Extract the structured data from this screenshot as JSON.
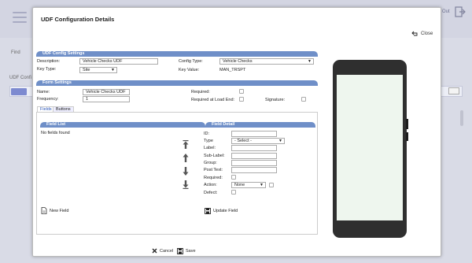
{
  "background": {
    "out_label": "Out",
    "find_label": "Find",
    "udf_config_label": "UDF Confi"
  },
  "modal": {
    "title": "UDF Configuration Details",
    "close_label": "Close"
  },
  "udf_config": {
    "header": "UDF Config Settings",
    "description_label": "Description:",
    "description_value": "Vehicle Checks UDF",
    "key_type_label": "Key Type:",
    "key_type_value": "Site",
    "config_type_label": "Config Type:",
    "config_type_value": "Vehicle Checks",
    "key_value_label": "Key Value:",
    "key_value_value": "MAN_TRSPT"
  },
  "form_settings": {
    "header": "Form Settings",
    "name_label": "Name:",
    "name_value": "Vehicle Checks UDF",
    "frequency_label": "Frequency:",
    "frequency_value": "1",
    "required_label": "Required:",
    "required_at_load_end_label": "Required at Load End:",
    "signature_label": "Signature:"
  },
  "tabs": [
    {
      "label": "Fields"
    },
    {
      "label": "Buttons"
    }
  ],
  "field_list": {
    "header": "Field List",
    "empty_text": "No fields found",
    "new_field_label": "New Field"
  },
  "field_detail": {
    "header": "Field Detail",
    "id_label": "ID:",
    "type_label": "Type",
    "type_value": "- Select -",
    "label_label": "Label:",
    "sub_label_label": "Sub-Label:",
    "group_label": "Group:",
    "post_text_label": "Post Text:",
    "required_label": "Required:",
    "action_label": "Action:",
    "action_value": "None",
    "defect_label": "Defect:",
    "update_field_label": "Update Field"
  },
  "footer": {
    "cancel_label": "Cancel",
    "save_label": "Save"
  },
  "icons": {
    "close": "back-arrow-icon",
    "cancel": "x-icon",
    "save": "floppy-icon",
    "new_field": "document-icon",
    "update_field": "floppy-icon",
    "move_top": "arrow-top-icon",
    "move_up": "arrow-up-icon",
    "move_down": "arrow-down-icon",
    "move_bottom": "arrow-bottom-icon"
  },
  "colors": {
    "section_header": "#6f8fc8",
    "phone_screen": "#eef6ee"
  }
}
